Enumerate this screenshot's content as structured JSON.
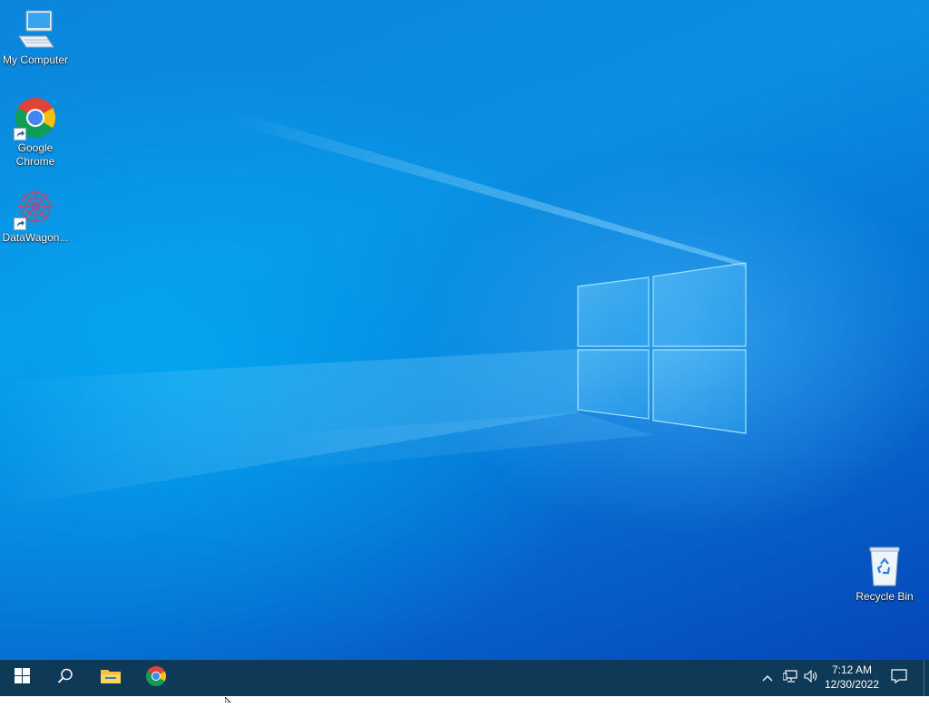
{
  "desktop": {
    "icons": [
      {
        "label": "My Computer",
        "icon": "computer-icon"
      },
      {
        "label": "Google Chrome",
        "icon": "chrome-icon"
      },
      {
        "label": "DataWagon...",
        "icon": "datawagon-icon"
      },
      {
        "label": "Recycle Bin",
        "icon": "recycle-bin-icon"
      }
    ]
  },
  "taskbar": {
    "start_icon": "windows-logo-icon",
    "search_icon": "search-icon",
    "pinned": [
      {
        "name": "File Explorer",
        "icon": "folder-icon"
      },
      {
        "name": "Google Chrome",
        "icon": "chrome-icon"
      }
    ],
    "tray": {
      "chevron_icon": "chevron-up-icon",
      "network_icon": "network-icon",
      "volume_icon": "speaker-icon",
      "notification_icon": "notification-icon"
    },
    "clock": {
      "time": "7:12 AM",
      "date": "12/30/2022"
    }
  },
  "colors": {
    "taskbar": "#0e3a57",
    "desktop_blue": "#0a86dc",
    "light_beam": "#58c8ff"
  }
}
